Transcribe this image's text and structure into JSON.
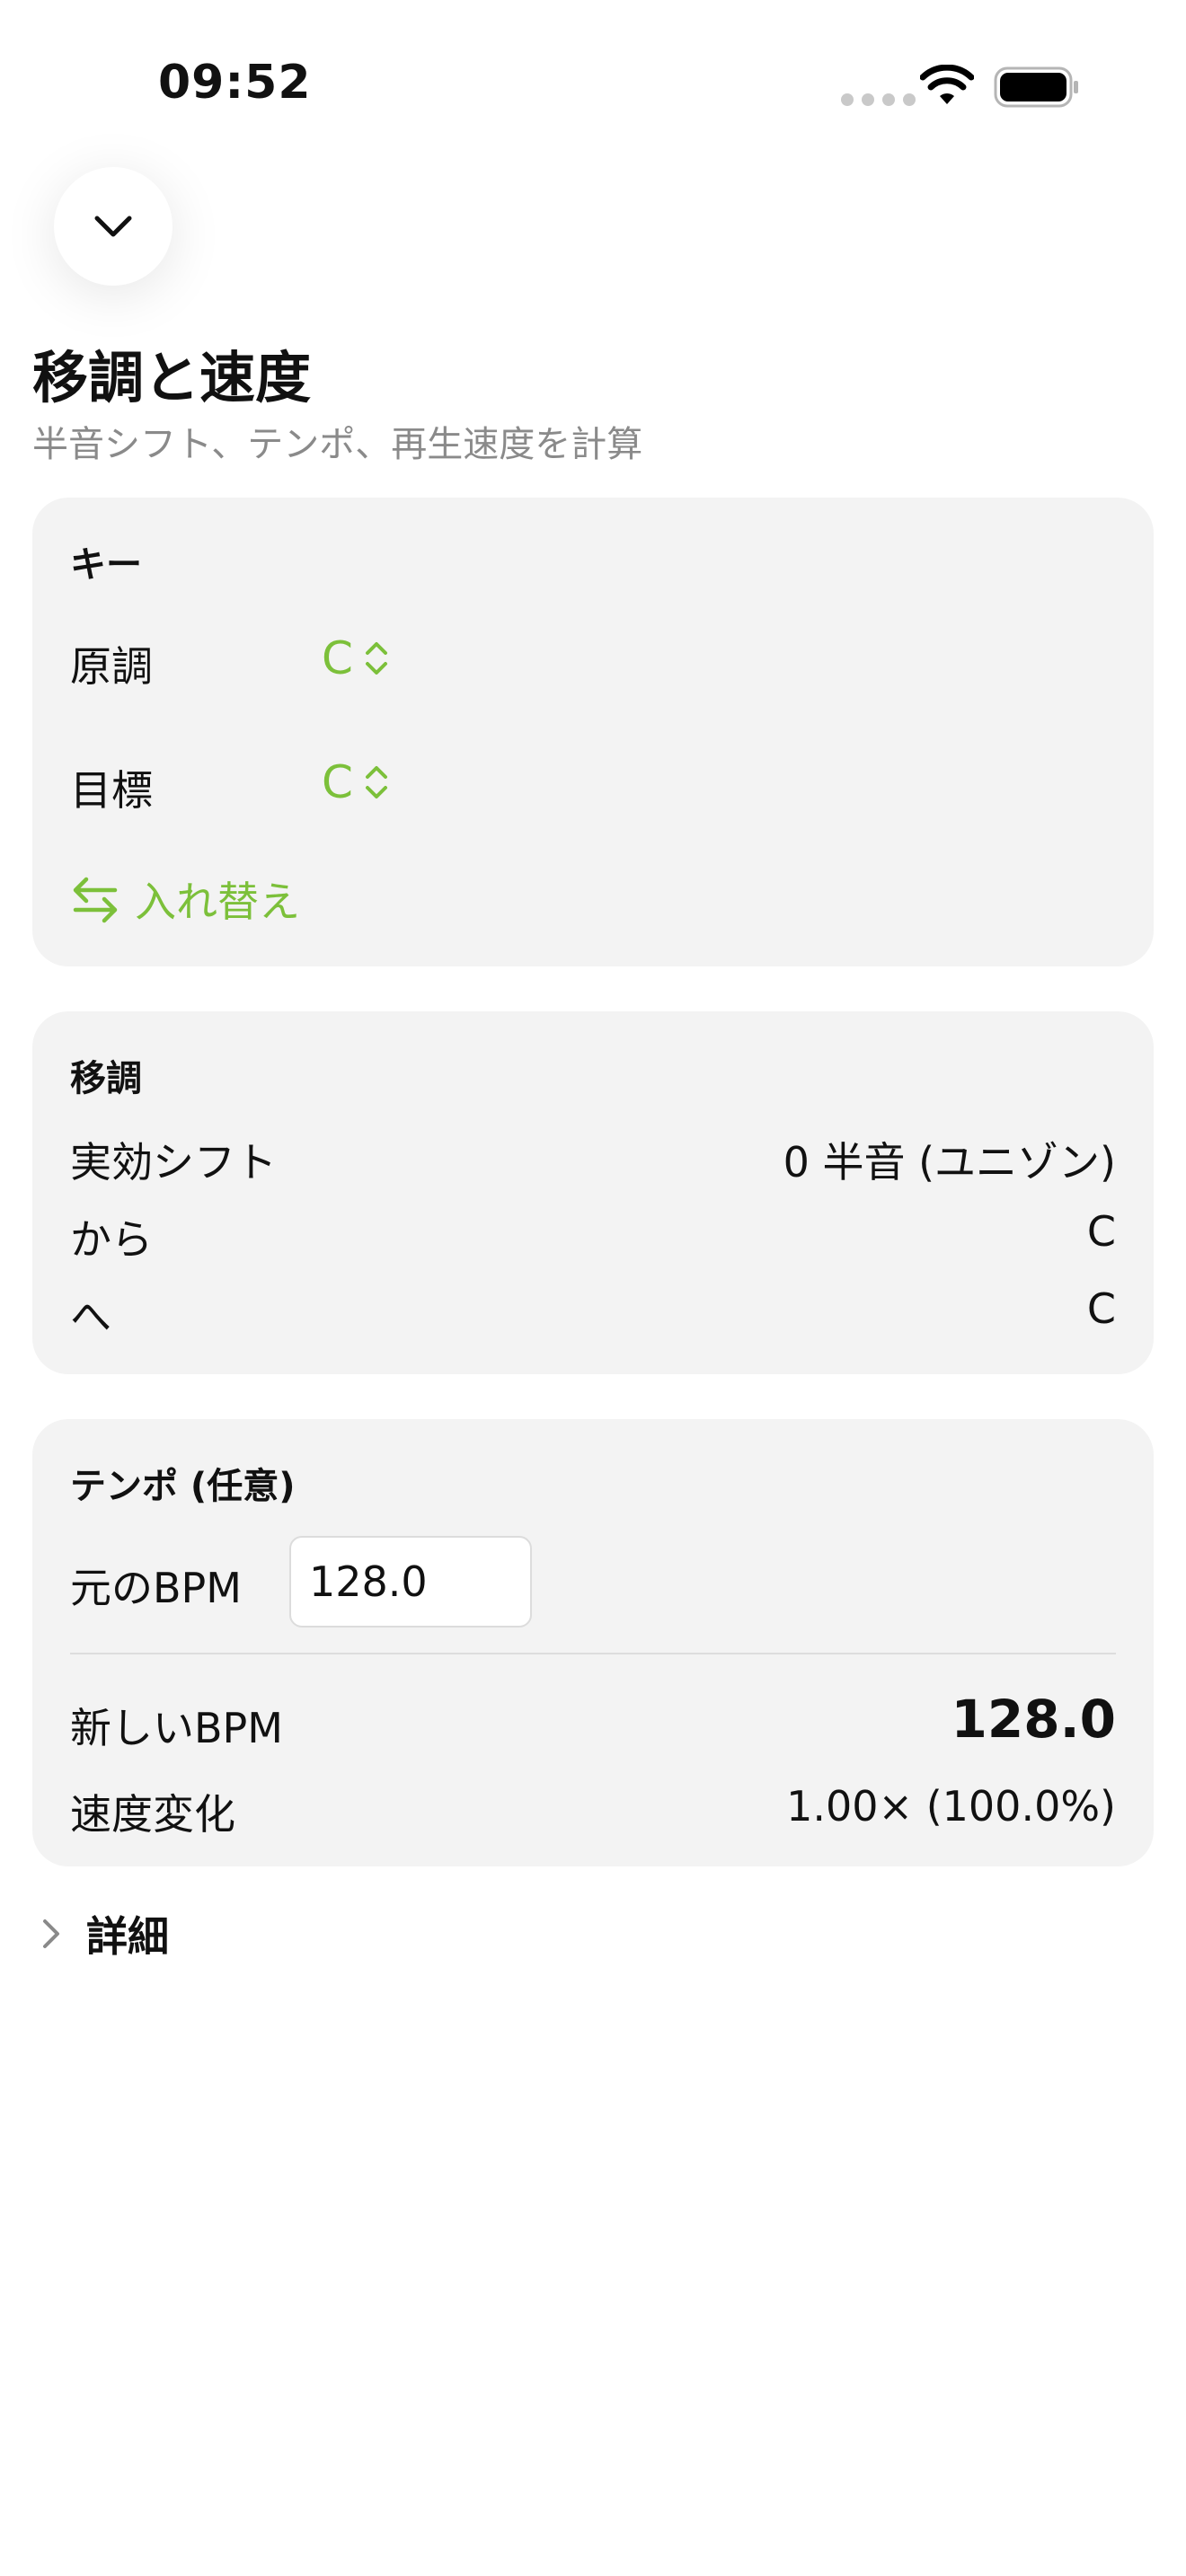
{
  "status_bar": {
    "time": "09:52"
  },
  "header": {
    "title": "移調と速度",
    "subtitle": "半音シフト、テンポ、再生速度を計算"
  },
  "key_section": {
    "heading": "キー",
    "original_label": "原調",
    "original_value": "C",
    "target_label": "目標",
    "target_value": "C",
    "swap_label": "入れ替え"
  },
  "transpose_section": {
    "heading": "移調",
    "rows": [
      {
        "label": "実効シフト",
        "value": "0 半音 (ユニゾン)"
      },
      {
        "label": "から",
        "value": "C"
      },
      {
        "label": "へ",
        "value": "C"
      }
    ]
  },
  "tempo_section": {
    "heading": "テンポ (任意)",
    "original_bpm_label": "元のBPM",
    "original_bpm_value": "128.0",
    "new_bpm_label": "新しいBPM",
    "new_bpm_value": "128.0",
    "speed_change_label": "速度変化",
    "speed_change_value": "1.00× (100.0%)"
  },
  "details": {
    "label": "詳細"
  },
  "colors": {
    "accent": "#7cc03a",
    "card_background": "#f3f3f3",
    "secondary_text": "#8a8a8a"
  }
}
